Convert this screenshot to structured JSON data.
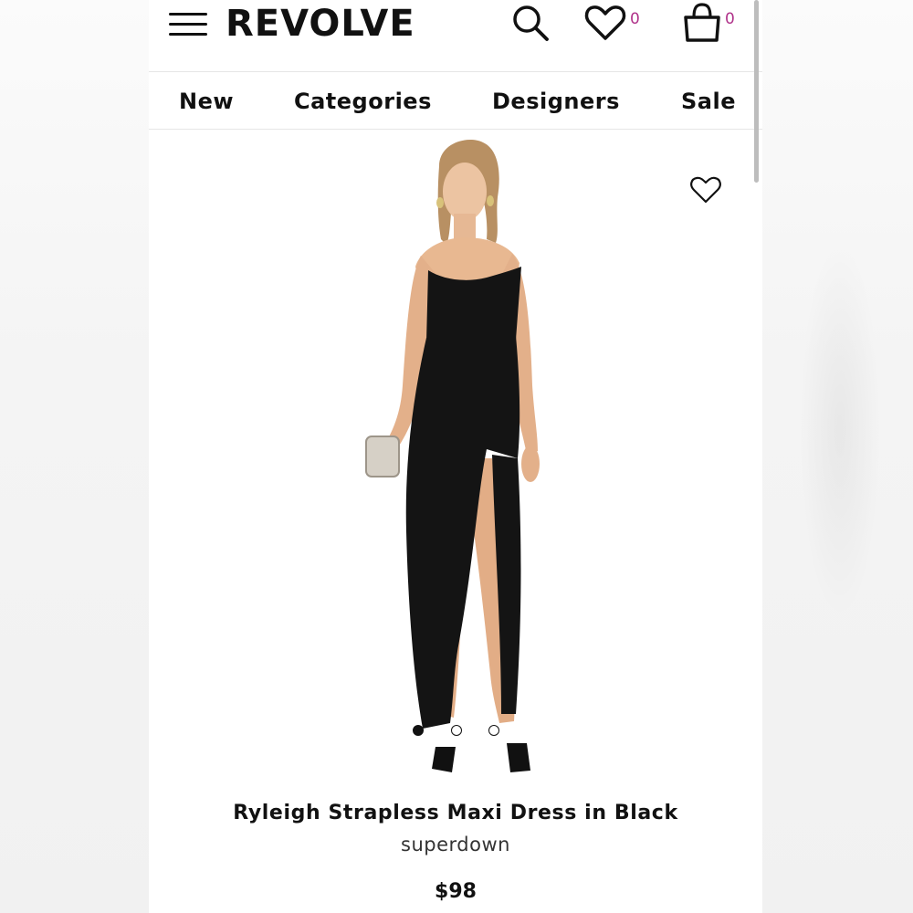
{
  "header": {
    "logo": "REVOLVE",
    "wishlist_count": "0",
    "bag_count": "0"
  },
  "nav": {
    "items": [
      {
        "label": "New"
      },
      {
        "label": "Categories"
      },
      {
        "label": "Designers"
      },
      {
        "label": "Sale"
      }
    ]
  },
  "gallery": {
    "image_count": 3,
    "active_index": 0
  },
  "product": {
    "name": "Ryleigh Strapless Maxi Dress in Black",
    "brand": "superdown",
    "price": "$98"
  },
  "icons": {
    "menu": "hamburger-menu-icon",
    "search": "search-icon",
    "wishlist": "heart-icon",
    "bag": "shopping-bag-icon"
  },
  "colors": {
    "text": "#111111",
    "count_badge": "#b0338a",
    "dress": "#141414"
  }
}
